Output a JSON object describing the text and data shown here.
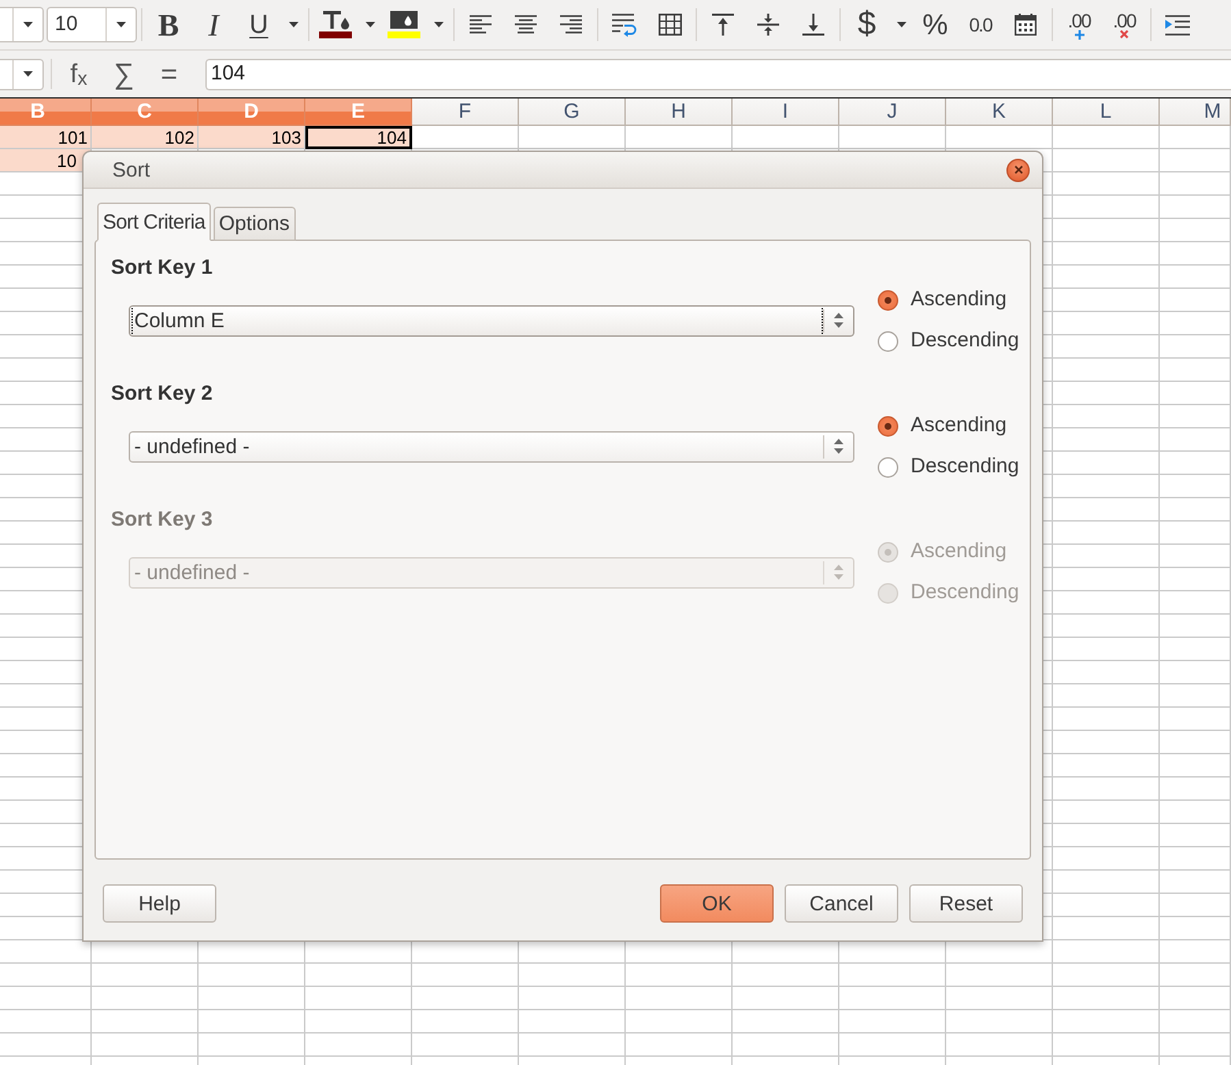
{
  "toolbar": {
    "font_size": "10",
    "groups": [
      [
        {
          "kind": "bold",
          "label": "B",
          "dropdown": false
        },
        {
          "kind": "italic",
          "label": "I",
          "dropdown": false
        },
        {
          "kind": "underline",
          "label": "U",
          "dropdown": true
        }
      ],
      [
        {
          "kind": "font-color",
          "dropdown": true
        },
        {
          "kind": "highlight",
          "dropdown": true
        }
      ],
      [
        {
          "kind": "align-left",
          "dropdown": false
        },
        {
          "kind": "align-center",
          "dropdown": false
        },
        {
          "kind": "align-right",
          "dropdown": false
        }
      ],
      [
        {
          "kind": "wrap",
          "dropdown": false
        },
        {
          "kind": "merge",
          "dropdown": false
        }
      ],
      [
        {
          "kind": "align-top",
          "dropdown": false
        },
        {
          "kind": "align-middle",
          "dropdown": false
        },
        {
          "kind": "align-bottom",
          "dropdown": false
        }
      ],
      [
        {
          "kind": "currency",
          "label": "$",
          "dropdown": true
        },
        {
          "kind": "percent",
          "label": "%",
          "dropdown": false
        },
        {
          "kind": "number",
          "label": "0.0",
          "dropdown": false
        },
        {
          "kind": "date",
          "dropdown": false
        }
      ],
      [
        {
          "kind": "add-decimal",
          "label": ".00",
          "dropdown": false
        },
        {
          "kind": "delete-decimal",
          "label": ".00",
          "dropdown": false
        }
      ],
      [
        {
          "kind": "indent",
          "dropdown": false
        }
      ]
    ]
  },
  "formula_bar": {
    "buttons": [
      {
        "kind": "function",
        "label": "f$_{x}$"
      },
      {
        "kind": "sum",
        "label": "∑"
      },
      {
        "kind": "equals",
        "label": "="
      }
    ],
    "value": "104"
  },
  "sheet": {
    "columns": [
      {
        "label": "B",
        "selected": true
      },
      {
        "label": "C",
        "selected": true
      },
      {
        "label": "D",
        "selected": true
      },
      {
        "label": "E",
        "selected": true
      },
      {
        "label": "F",
        "selected": false
      },
      {
        "label": "G",
        "selected": false
      },
      {
        "label": "H",
        "selected": false
      },
      {
        "label": "I",
        "selected": false
      },
      {
        "label": "J",
        "selected": false
      },
      {
        "label": "K",
        "selected": false
      },
      {
        "label": "L",
        "selected": false
      },
      {
        "label": "M",
        "selected": false
      }
    ],
    "rows": [
      {
        "cells": [
          {
            "value": "101",
            "selected": true,
            "active": false
          },
          {
            "value": "102",
            "selected": true,
            "active": false
          },
          {
            "value": "103",
            "selected": true,
            "active": false
          },
          {
            "value": "104",
            "selected": true,
            "active": true
          }
        ]
      },
      {
        "cells": [
          {
            "value": "10",
            "selected": true,
            "active": false
          }
        ]
      }
    ]
  },
  "dialog": {
    "title": "Sort",
    "tabs": [
      {
        "label": "Sort Criteria",
        "selected": true
      },
      {
        "label": "Options",
        "selected": false
      }
    ],
    "sort_keys": [
      {
        "label": "Sort Key 1",
        "value": "Column E",
        "focused": true,
        "disabled": false,
        "order": [
          {
            "label": "Ascending",
            "selected": true
          },
          {
            "label": "Descending",
            "selected": false
          }
        ]
      },
      {
        "label": "Sort Key 2",
        "value": "- undefined -",
        "focused": false,
        "disabled": false,
        "order": [
          {
            "label": "Ascending",
            "selected": true
          },
          {
            "label": "Descending",
            "selected": false
          }
        ]
      },
      {
        "label": "Sort Key 3",
        "value": "- undefined -",
        "focused": false,
        "disabled": true,
        "order": [
          {
            "label": "Ascending",
            "selected": true
          },
          {
            "label": "Descending",
            "selected": false
          }
        ]
      }
    ],
    "buttons": [
      {
        "label": "Help",
        "kind": "help"
      },
      {
        "label": "OK",
        "kind": "primary"
      },
      {
        "label": "Cancel",
        "kind": "default"
      },
      {
        "label": "Reset",
        "kind": "default"
      }
    ]
  }
}
